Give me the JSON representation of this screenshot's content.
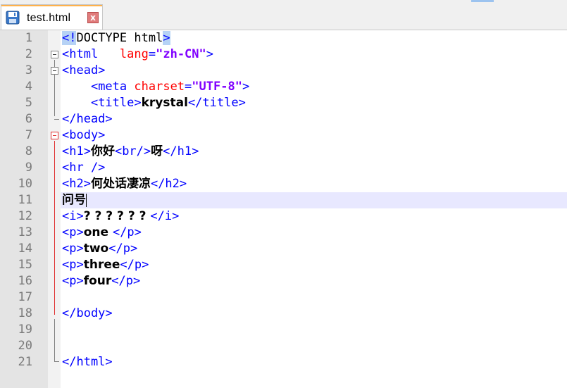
{
  "tab": {
    "title": "test.html",
    "close_label": "x",
    "save_icon": "save-disk-icon"
  },
  "colors": {
    "tag": "#0000ff",
    "attr": "#ff0000",
    "value": "#8000ff",
    "current_line": "#e8e8ff",
    "fold_active": "#e03030"
  },
  "lines": [
    {
      "n": "1"
    },
    {
      "n": "2"
    },
    {
      "n": "3"
    },
    {
      "n": "4"
    },
    {
      "n": "5"
    },
    {
      "n": "6"
    },
    {
      "n": "7"
    },
    {
      "n": "8"
    },
    {
      "n": "9"
    },
    {
      "n": "10"
    },
    {
      "n": "11"
    },
    {
      "n": "12"
    },
    {
      "n": "13"
    },
    {
      "n": "14"
    },
    {
      "n": "15"
    },
    {
      "n": "16"
    },
    {
      "n": "17"
    },
    {
      "n": "18"
    },
    {
      "n": "19"
    },
    {
      "n": "20"
    },
    {
      "n": "21"
    }
  ],
  "code": {
    "l1_open": "<!",
    "l1_doctype": "DOCTYPE html",
    "l1_close": ">",
    "l2_tag": "<html",
    "l2_attr": "lang",
    "l2_eq": "=",
    "l2_val": "\"zh-CN\"",
    "l2_end": ">",
    "l3_tag": "<head>",
    "l4_tag": "<meta",
    "l4_attr": "charset",
    "l4_eq": "=",
    "l4_val": "\"UTF-8\"",
    "l4_end": ">",
    "l5_open": "<title>",
    "l5_text": "krystal",
    "l5_close": "</title>",
    "l6_tag": "</head>",
    "l7_tag": "<body>",
    "l8_open": "<h1>",
    "l8_text": "你好",
    "l8_br": "<br/>",
    "l8_text2": "呀",
    "l8_close": "</h1>",
    "l9_tag": "<hr />",
    "l10_open": "<h2>",
    "l10_text": "何处话凄凉",
    "l10_close": "</h2>",
    "l11_text": "问号",
    "l12_open": "<i>",
    "l12_text": "? ? ? ? ? ? ",
    "l12_close": "</i>",
    "l13_open": "<p>",
    "l13_text": "one ",
    "l13_close": "</p>",
    "l14_open": "<p>",
    "l14_text": "two",
    "l14_close": "</p>",
    "l15_open": "<p>",
    "l15_text": "three",
    "l15_close": "</p>",
    "l16_open": "<p>",
    "l16_text": "four",
    "l16_close": "</p>",
    "l18_tag": "</body>",
    "l21_tag": "</html>"
  }
}
